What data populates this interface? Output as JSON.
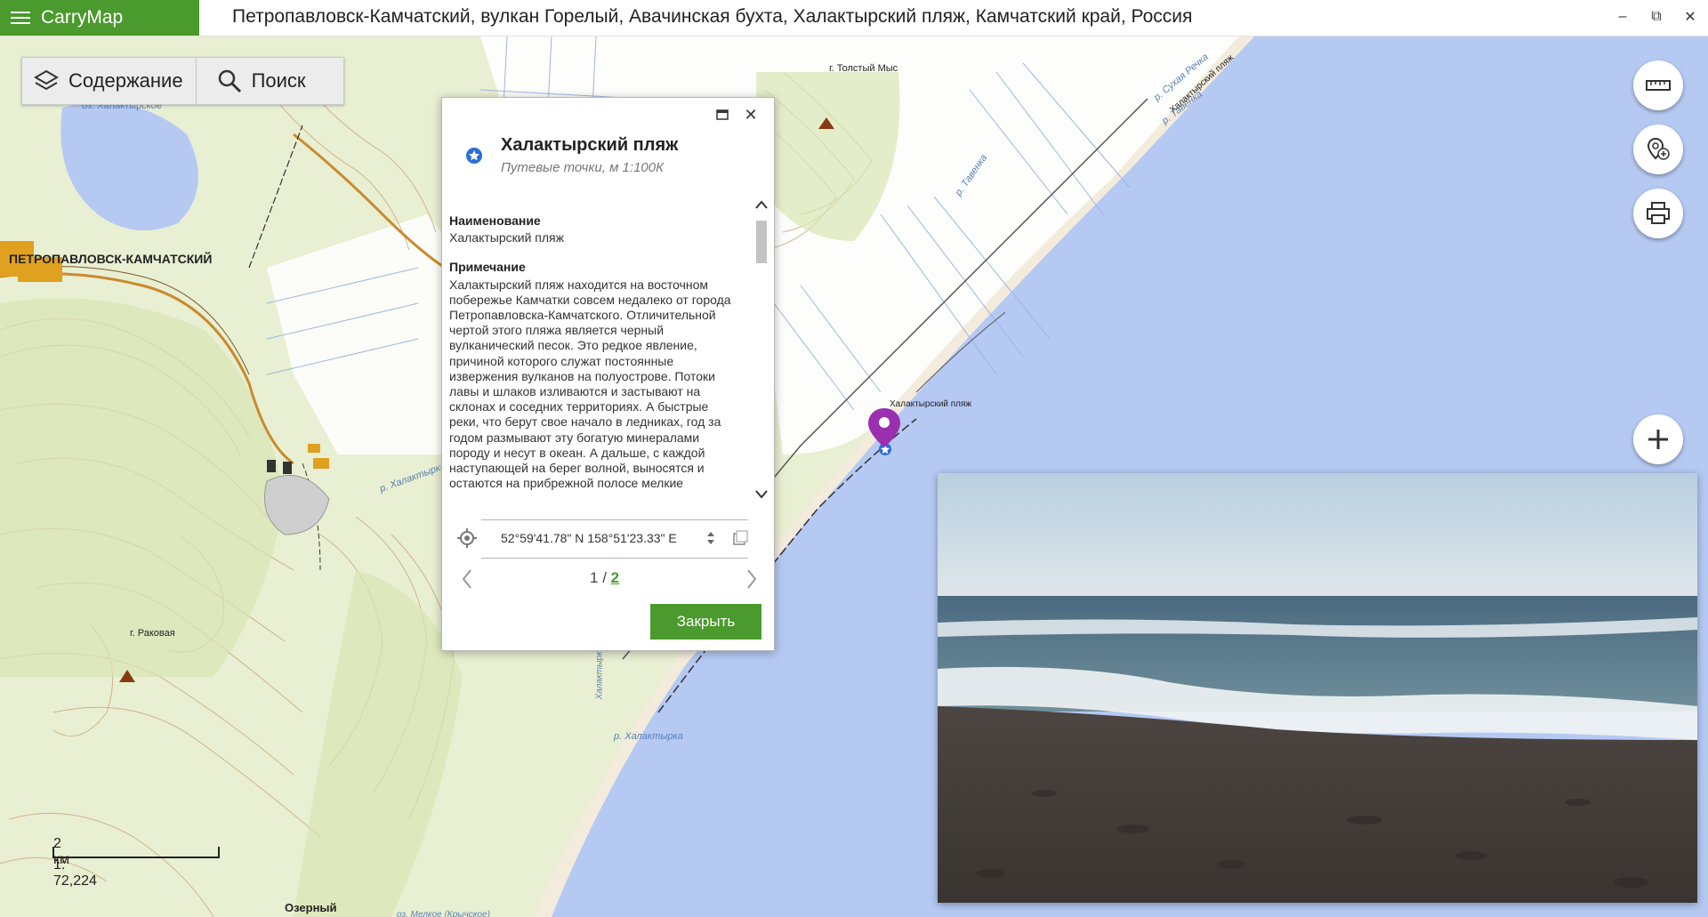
{
  "app": {
    "name": "CarryMap"
  },
  "window": {
    "title": "Петропавловск-Камчатский, вулкан Горелый, Авачинская бухта, Халактырский пляж, Камчатский край, Россия",
    "minimize": "–",
    "restore": "⧉",
    "close": "✕"
  },
  "toolbar": {
    "contents_label": "Содержание",
    "search_label": "Поиск"
  },
  "popup": {
    "title": "Халактырский пляж",
    "subtitle": "Путевые точки, м 1:100К",
    "fields": [
      {
        "label": "Наименование",
        "value": "Халактырский пляж"
      },
      {
        "label": "Примечание",
        "value": "Халактырский пляж находится на восточном побережье Камчатки совсем недалеко от города Петропавловска-Камчатского. Отличительной чертой этого пляжа является черный вулканический песок. Это редкое явление, причиной которого служат постоянные извержения вулканов на полуострове. Потоки лавы и шлаков изливаются и застывают на склонах и соседних территориях. А быстрые реки, что берут свое начало в ледниках, год за годом размывают эту богатую минералами породу и несут в океан. А дальше, с каждой наступающей на берег волной, выносятся и остаются на прибрежной полосе мелкие"
      }
    ],
    "coordinates": "52°59'41.78\" N 158°51'23.33\" E",
    "page_current": "1",
    "page_separator": " / ",
    "page_total": "2",
    "close_label": "Закрыть"
  },
  "map": {
    "labels": {
      "city": "ПЕТРОПАВЛОВСК-КАМЧАТСКИЙ",
      "lake": "оз. Халактырское",
      "mountain1": "г. Толстый Мыс",
      "mountain2": "г. Раковая",
      "beach": "Халактырский пляж",
      "river1": "р. Халактырка",
      "river2": "р. Халактырка",
      "river3": "р. Тавенка",
      "river4": "р. Сухая Речка",
      "river5": "р. Тавенка",
      "coast": "Халактырский пляж",
      "settlement": "Озерный",
      "bottom": "оз. Мелкое (Крычское)",
      "vertical": "Халактырка"
    }
  },
  "scale": {
    "distance": "2 км",
    "ratio": "1: 72,224"
  },
  "colors": {
    "accent": "#4a9a2d",
    "sea": "#b5c9f3",
    "land": "#e9efd2",
    "marker": "#9a2fb0"
  }
}
